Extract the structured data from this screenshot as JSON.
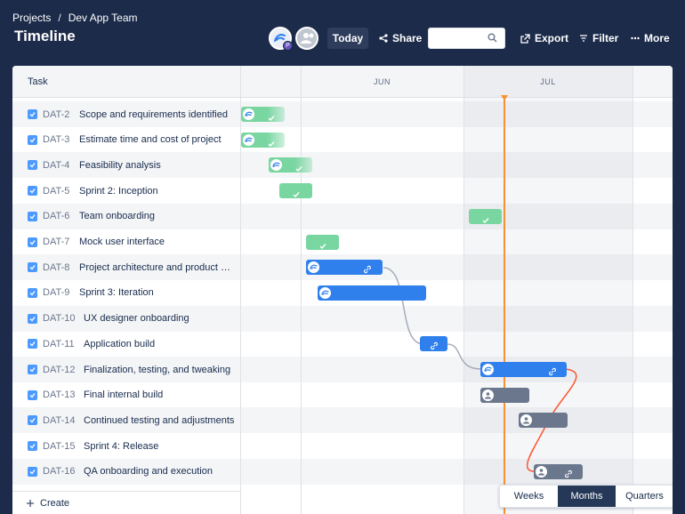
{
  "breadcrumb": {
    "projects": "Projects",
    "separator": "/",
    "team": "Dev App Team"
  },
  "title": "Timeline",
  "avatar_badge": "P",
  "toolbar": {
    "today": "Today",
    "share": "Share",
    "export": "Export",
    "filter": "Filter",
    "more": "More",
    "search_placeholder": ""
  },
  "task_header": "Task",
  "months": [
    "JUN",
    "JUL"
  ],
  "tasks": [
    {
      "key": "DAT-2",
      "name": "Scope and requirements identified",
      "done": true
    },
    {
      "key": "DAT-3",
      "name": "Estimate time and cost of project",
      "done": true
    },
    {
      "key": "DAT-4",
      "name": "Feasibility analysis",
      "done": true
    },
    {
      "key": "DAT-5",
      "name": "Sprint 2: Inception",
      "done": true
    },
    {
      "key": "DAT-6",
      "name": "Team onboarding",
      "done": true
    },
    {
      "key": "DAT-7",
      "name": "Mock user interface",
      "done": true
    },
    {
      "key": "DAT-8",
      "name": "Project architecture and product fu...",
      "done": true
    },
    {
      "key": "DAT-9",
      "name": "Sprint 3: Iteration",
      "done": true
    },
    {
      "key": "DAT-10",
      "name": "UX designer onboarding",
      "done": true
    },
    {
      "key": "DAT-11",
      "name": "Application build",
      "done": true
    },
    {
      "key": "DAT-12",
      "name": "Finalization, testing, and tweaking",
      "done": true
    },
    {
      "key": "DAT-13",
      "name": "Final internal build",
      "done": true
    },
    {
      "key": "DAT-14",
      "name": "Continued testing and adjustments",
      "done": true
    },
    {
      "key": "DAT-15",
      "name": "Sprint 4: Release",
      "done": true
    },
    {
      "key": "DAT-16",
      "name": "QA onboarding and execution",
      "done": true
    }
  ],
  "create_label": "Create",
  "views": {
    "weeks": "Weeks",
    "months": "Months",
    "quarters": "Quarters",
    "selected": "Months"
  },
  "colors": {
    "done": "#79d6a1",
    "in_progress": "#2f80ed",
    "todo": "#6b778c",
    "today_marker": "#f79232",
    "dependency_ok": "#a5adba",
    "dependency_conflict": "#ff5630"
  }
}
